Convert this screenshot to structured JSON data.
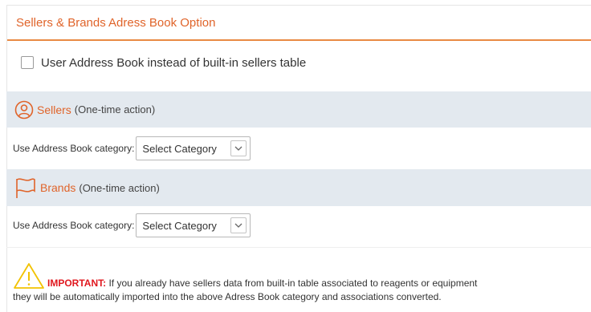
{
  "panel": {
    "title": "Sellers & Brands Adress Book Option"
  },
  "option": {
    "label": "User Address Book instead of built-in sellers table",
    "checked": false
  },
  "sellers": {
    "icon": "user-circle-icon",
    "title": "Sellers",
    "note": "(One-time action)",
    "field_label": "Use Address Book category:",
    "select_value": "Select Category"
  },
  "brands": {
    "icon": "flag-icon",
    "title": "Brands",
    "note": "(One-time action)",
    "field_label": "Use Address Book category:",
    "select_value": "Select Category"
  },
  "notice": {
    "icon": "warning-triangle-icon",
    "important_label": "IMPORTANT:",
    "line1": "If you already have sellers data from built-in table associated to reagents or equipment",
    "line2": "they will be automatically imported into the above Adress Book category and associations converted."
  },
  "colors": {
    "accent": "#e0642a",
    "section_bg": "#e3e9ef",
    "important": "#e0171e"
  }
}
